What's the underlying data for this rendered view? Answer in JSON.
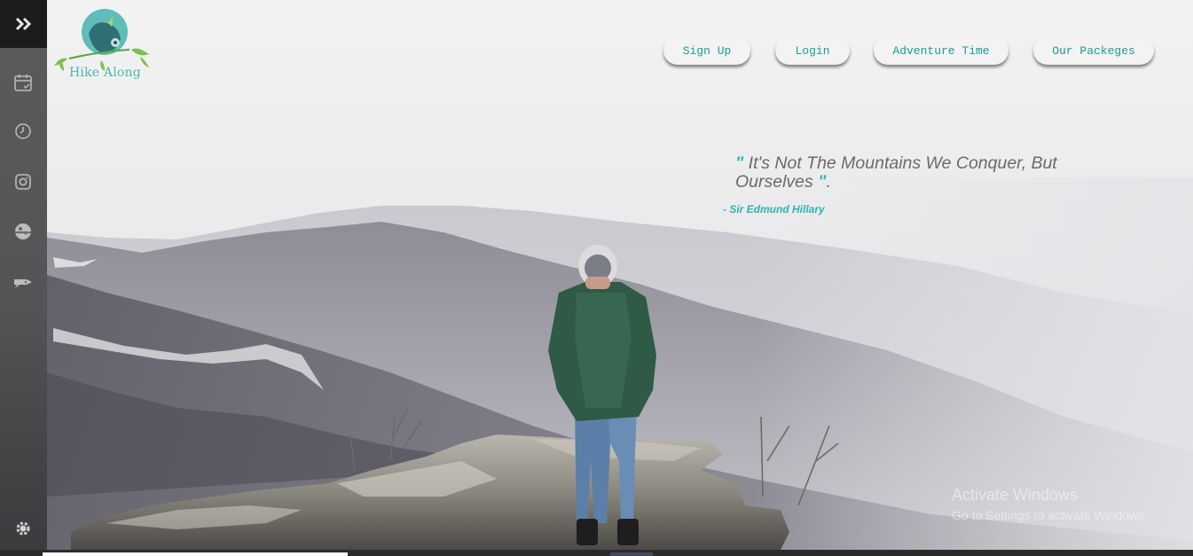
{
  "brand": {
    "name": "Hike Along"
  },
  "nav": {
    "items": [
      {
        "label": "Sign Up"
      },
      {
        "label": "Login"
      },
      {
        "label": "Adventure Time"
      },
      {
        "label": "Our Packeges"
      }
    ]
  },
  "sidebar": {
    "icons": [
      "double-chevron-right-icon",
      "calendar-icon",
      "clock-icon",
      "instagram-icon",
      "planet-icon",
      "rocket-icon",
      "settings-icon"
    ]
  },
  "hero": {
    "quote_open": "\"",
    "quote_text": " It's Not The Mountains We Conquer, But Ourselves ",
    "quote_close": "\"",
    "quote_period": ".",
    "author": "- Sir Edmund Hillary"
  },
  "watermark": {
    "title": "Activate Windows",
    "subtitle": "Go to Settings to activate Windows."
  },
  "colors": {
    "accent": "#35b9b3",
    "sidebar_top": "#1c1c1e",
    "quote_text": "#6a6a6a"
  }
}
